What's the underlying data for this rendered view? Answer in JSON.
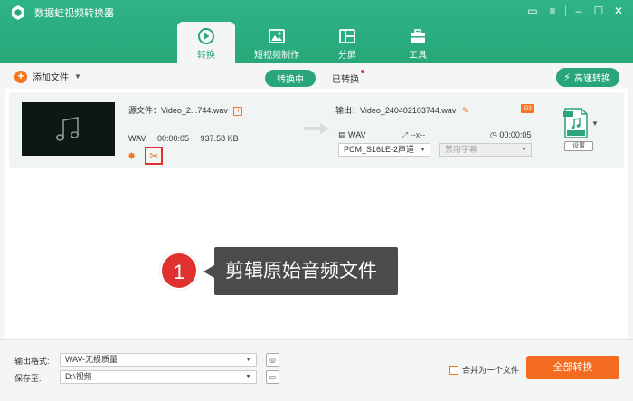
{
  "app": {
    "title": "数据蛙视频转换器"
  },
  "tabs": [
    {
      "label": "转换",
      "icon": "convert-icon",
      "active": true
    },
    {
      "label": "短视频制作",
      "icon": "video-maker-icon",
      "active": false
    },
    {
      "label": "分屏",
      "icon": "split-screen-icon",
      "active": false
    },
    {
      "label": "工具",
      "icon": "toolbox-icon",
      "active": false
    }
  ],
  "toolbar": {
    "add_file": "添加文件",
    "converting": "转换中",
    "converted": "已转换",
    "fast_convert": "高速转换"
  },
  "file": {
    "source_label": "源文件：Video_2...744.wav",
    "format": "WAV",
    "duration": "00:00:05",
    "size": "937.58 KB",
    "output_label": "输出：Video_240402103744.wav",
    "out_format": "WAV",
    "out_resolution": "--x--",
    "out_duration": "00:00:05",
    "audio_track": "PCM_S16LE-2声道",
    "subtitle": "禁用字幕",
    "format_badge": "WAV",
    "settings": "设置"
  },
  "callout": {
    "number": "1",
    "text": "剪辑原始音频文件"
  },
  "bottom": {
    "output_format_label": "输出格式:",
    "output_format_value": "WAV-无损质量",
    "save_to_label": "保存至:",
    "save_to_value": "D:\\视频",
    "merge_label": "合并为一个文件",
    "convert_all": "全部转换"
  },
  "colors": {
    "brand_green": "#2aa57a",
    "accent_orange": "#f36b21",
    "highlight_red": "#e03131"
  }
}
